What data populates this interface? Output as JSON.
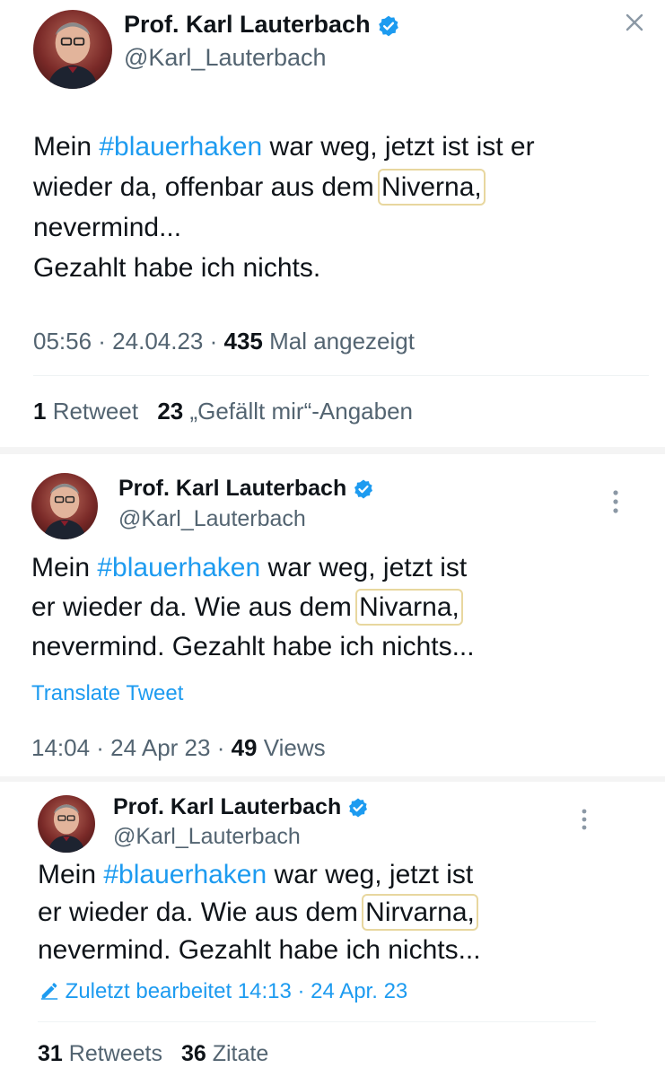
{
  "colors": {
    "accent": "#1d9bf0",
    "text": "#0f1419",
    "muted": "#536471",
    "highlight_box": "#e8d79f"
  },
  "tweet1": {
    "author_name": "Prof. Karl Lauterbach",
    "author_handle": "@Karl_Lauterbach",
    "text_part1": "Mein ",
    "hashtag": "#blauerhaken",
    "text_part2": " war weg, jetzt ist ist er",
    "text_line2_pre": "wieder da, offenbar aus dem ",
    "highlighted_word": "Niverna,",
    "text_line3": "nevermind...",
    "text_line4": "Gezahlt habe ich nichts.",
    "time": "05:56 · 24.04.23 · ",
    "views_count": "435",
    "views_label": " Mal angezeigt",
    "retweet_count": "1",
    "retweet_label": " Retweet",
    "likes_count": "23",
    "likes_label": " „Gefällt mir“-Angaben"
  },
  "tweet2": {
    "author_name": "Prof. Karl Lauterbach",
    "author_handle": "@Karl_Lauterbach",
    "text_part1": "Mein ",
    "hashtag": "#blauerhaken",
    "text_part2": " war weg, jetzt ist",
    "text_line2_pre": "er wieder da. Wie aus dem ",
    "highlighted_word": "Nivarna,",
    "text_line3": "nevermind. Gezahlt habe ich nichts...",
    "translate_label": "Translate Tweet",
    "time": "14:04 · 24 Apr 23 · ",
    "views_count": "49",
    "views_label": " Views"
  },
  "tweet3": {
    "author_name": "Prof. Karl Lauterbach",
    "author_handle": "@Karl_Lauterbach",
    "text_part1": "Mein ",
    "hashtag": "#blauerhaken",
    "text_part2": " war weg, jetzt ist",
    "text_line2_pre": "er wieder da. Wie aus dem ",
    "highlighted_word": "Nirvarna,",
    "text_line3": "nevermind. Gezahlt habe ich nichts...",
    "edited_label": "Zuletzt bearbeitet 14:13 · 24 Apr. 23",
    "retweets_count": "31",
    "retweets_label": " Retweets",
    "quotes_count": "36",
    "quotes_label": " Zitate"
  },
  "icons": {
    "verified": "verified-badge-icon",
    "close": "close-icon",
    "more": "more-vertical-icon",
    "edit": "pencil-icon"
  }
}
